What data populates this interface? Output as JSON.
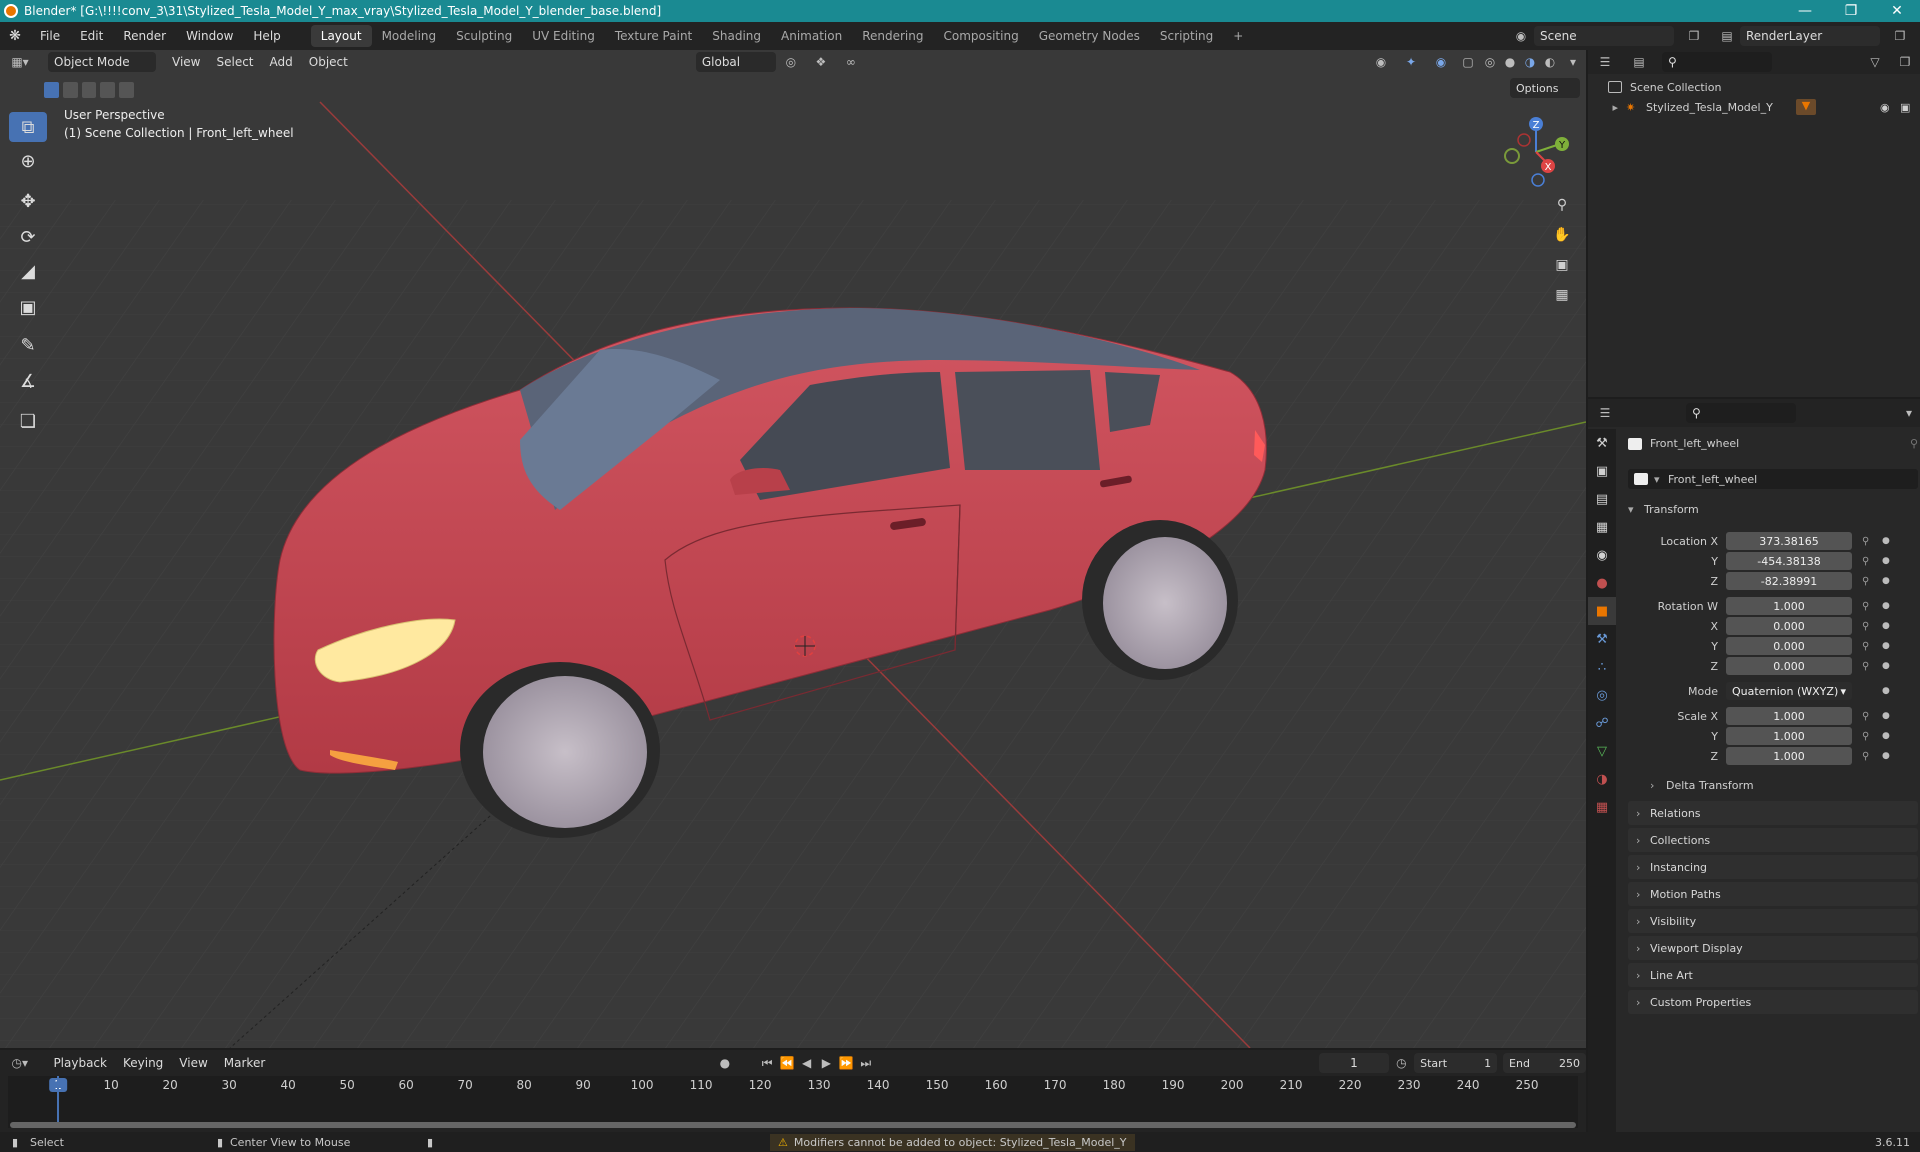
{
  "window": {
    "title": "Blender* [G:\\!!!!conv_3\\31\\Stylized_Tesla_Model_Y_max_vray\\Stylized_Tesla_Model_Y_blender_base.blend]"
  },
  "menu": {
    "items": [
      "File",
      "Edit",
      "Render",
      "Window",
      "Help"
    ]
  },
  "workspaces": [
    "Layout",
    "Modeling",
    "Sculpting",
    "UV Editing",
    "Texture Paint",
    "Shading",
    "Animation",
    "Rendering",
    "Compositing",
    "Geometry Nodes",
    "Scripting"
  ],
  "workspace_add": "+",
  "scene": {
    "name": "Scene",
    "render_layer": "RenderLayer"
  },
  "viewport": {
    "mode": "Object Mode",
    "menus": [
      "View",
      "Select",
      "Add",
      "Object"
    ],
    "transform_orientation": "Global",
    "options": "Options",
    "overlay_title": "User Perspective",
    "overlay_sub": "(1) Scene Collection | Front_left_wheel",
    "gizmo_axes": {
      "x": "X",
      "y": "Y",
      "z": "Z"
    }
  },
  "outliner": {
    "root": "Scene Collection",
    "items": [
      {
        "name": "Stylized_Tesla_Model_Y"
      }
    ]
  },
  "properties": {
    "object_name": "Front_left_wheel",
    "data_name": "Front_left_wheel",
    "transform_label": "Transform",
    "location_label": "Location X",
    "location": {
      "x": "373.38165",
      "y": "-454.38138",
      "z": "-82.38991"
    },
    "rotation_label": "Rotation W",
    "rotation": {
      "w": "1.000",
      "x": "0.000",
      "y": "0.000",
      "z": "0.000"
    },
    "mode_label": "Mode",
    "mode_value": "Quaternion (WXYZ)",
    "scale_label": "Scale X",
    "scale": {
      "x": "1.000",
      "y": "1.000",
      "z": "1.000"
    },
    "axis_labels": {
      "x": "X",
      "y": "Y",
      "z": "Z"
    },
    "delta_transform": "Delta Transform",
    "sections": [
      "Relations",
      "Collections",
      "Instancing",
      "Motion Paths",
      "Visibility",
      "Viewport Display",
      "Line Art",
      "Custom Properties"
    ]
  },
  "timeline": {
    "menus": [
      "Playback",
      "Keying",
      "View",
      "Marker"
    ],
    "current_frame": "1",
    "start_label": "Start",
    "start_value": "1",
    "end_label": "End",
    "end_value": "250",
    "ticks": [
      "1",
      "10",
      "20",
      "30",
      "40",
      "50",
      "60",
      "70",
      "80",
      "90",
      "100",
      "110",
      "120",
      "130",
      "140",
      "150",
      "160",
      "170",
      "180",
      "190",
      "200",
      "210",
      "220",
      "230",
      "240",
      "250"
    ]
  },
  "status": {
    "select": "Select",
    "center": "Center View to Mouse",
    "warning": "Modifiers cannot be added to object: Stylized_Tesla_Model_Y",
    "version": "3.6.11"
  },
  "colors": {
    "accent": "#4772b3",
    "titlebar": "#1a8a92",
    "car_body": "#c8444f",
    "selection": "#ea7600"
  },
  "icons": [
    "blender-logo-icon",
    "select-box-icon",
    "cursor-icon",
    "move-icon",
    "rotate-icon",
    "scale-icon",
    "transform-icon",
    "annotate-icon",
    "measure-icon",
    "add-cube-icon",
    "zoom-icon",
    "hand-icon",
    "camera-icon",
    "grid-icon",
    "eye-icon",
    "camera-visibility-icon",
    "warning-icon"
  ]
}
